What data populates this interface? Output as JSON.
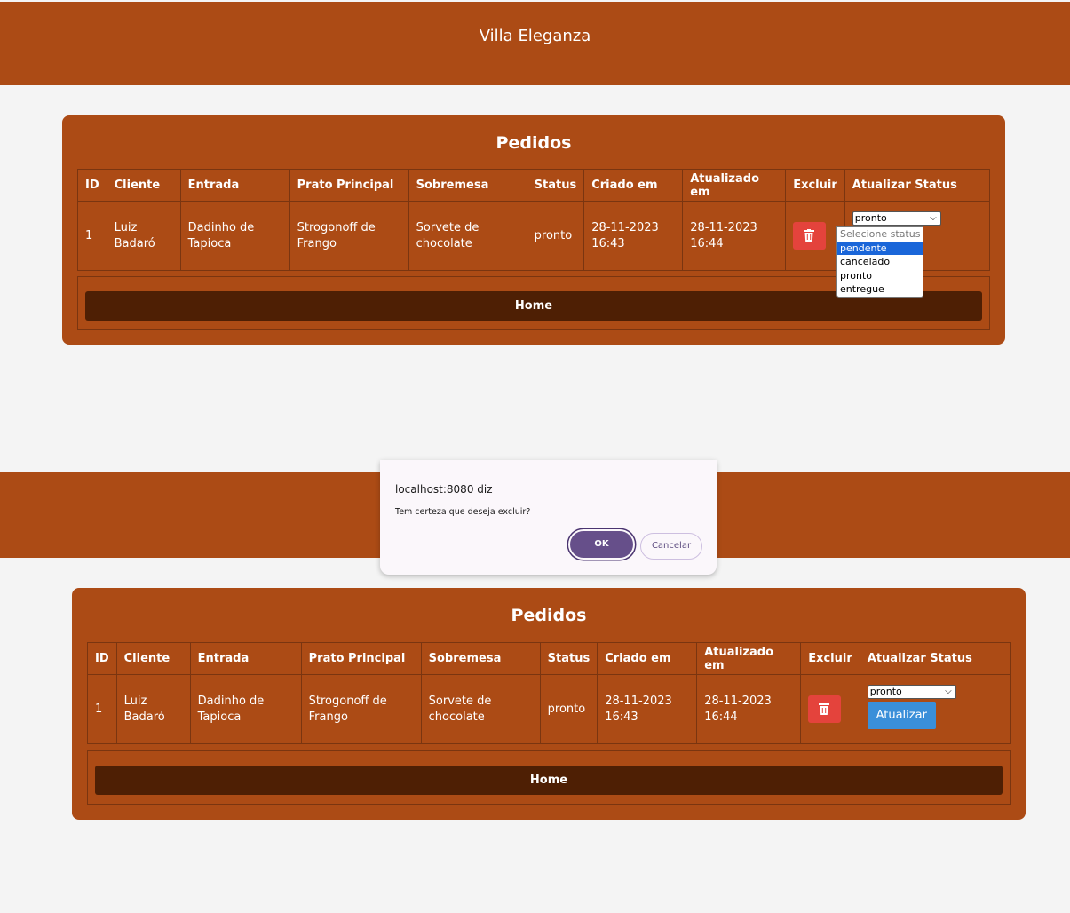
{
  "app": {
    "title": "Villa Eleganza"
  },
  "panel": {
    "title": "Pedidos"
  },
  "table": {
    "headers": [
      "ID",
      "Cliente",
      "Entrada",
      "Prato Principal",
      "Sobremesa",
      "Status",
      "Criado em",
      "Atualizado em",
      "Excluir",
      "Atualizar Status"
    ],
    "row": {
      "id": "1",
      "cliente_1": "Luiz",
      "cliente_2": "Badaró",
      "entrada_1": "Dadinho de",
      "entrada_2": "Tapioca",
      "prato_1": "Strogonoff de",
      "prato_2": "Frango",
      "sobremesa_1": "Sorvete de",
      "sobremesa_2": "chocolate",
      "status": "pronto",
      "criado_1": "28-11-2023",
      "criado_2": "16:43",
      "atualizado_1": "28-11-2023",
      "atualizado_2": "16:44",
      "selected_status": "pronto"
    }
  },
  "status_options": [
    "Selecione status",
    "pendente",
    "cancelado",
    "pronto",
    "entregue"
  ],
  "highlighted_option": "pendente",
  "home_button": "Home",
  "update_button": "Atualizar",
  "dialog": {
    "title": "localhost:8080 diz",
    "message": "Tem certeza que deseja excluir?",
    "ok": "OK",
    "cancel": "Cancelar"
  },
  "colors": {
    "brand": "#ac4b15",
    "home_button": "#4e1f04",
    "delete_button": "#e4433c",
    "update_button": "#3a8fd9",
    "dialog_ok": "#664f8a"
  },
  "icons": [
    "trash-icon",
    "chevron-down-icon"
  ]
}
